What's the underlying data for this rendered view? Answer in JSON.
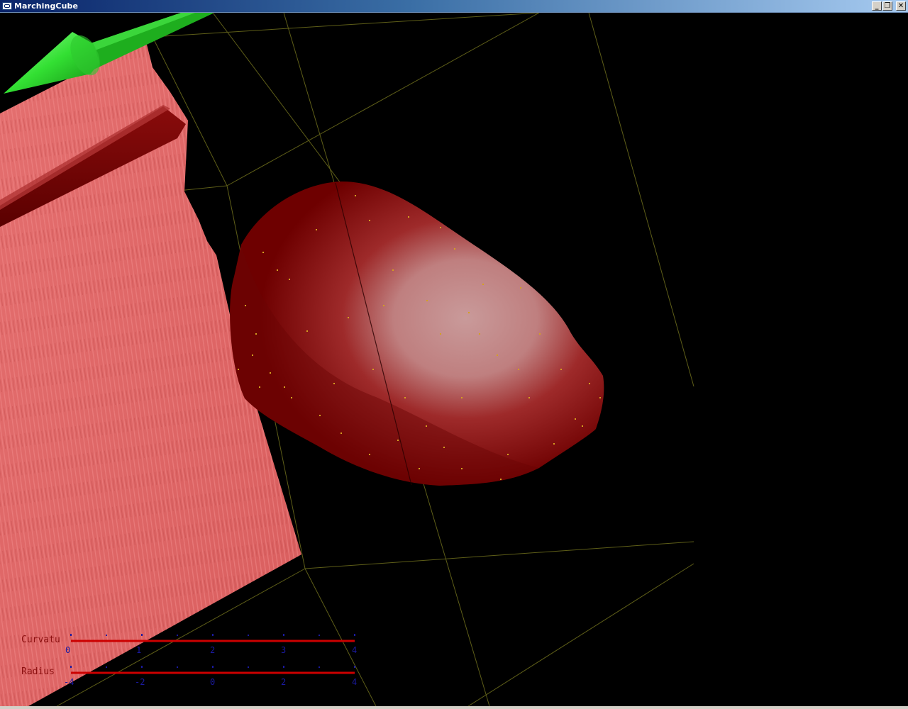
{
  "window": {
    "title": "MarchingCube",
    "buttons": {
      "minimize": "_",
      "restore": "❐",
      "close": "✕"
    }
  },
  "legend": {
    "curvature": {
      "label": "Curvatu",
      "ticks": [
        "0",
        "1",
        "2",
        "3",
        "4"
      ]
    },
    "radius": {
      "label": "Radius",
      "ticks": [
        "-4",
        "-2",
        "0",
        "2",
        "4"
      ]
    }
  },
  "colors": {
    "background": "#000000",
    "plane": "#e06a6a",
    "surface": "#8b0a0a",
    "surface_highlight": "#d98c8c",
    "wireframe": "#6b6b1a",
    "arrow": "#22dd22",
    "legend_label": "#8b1010",
    "legend_tick": "#1a1aa0",
    "legend_bar": "#cc0000"
  }
}
